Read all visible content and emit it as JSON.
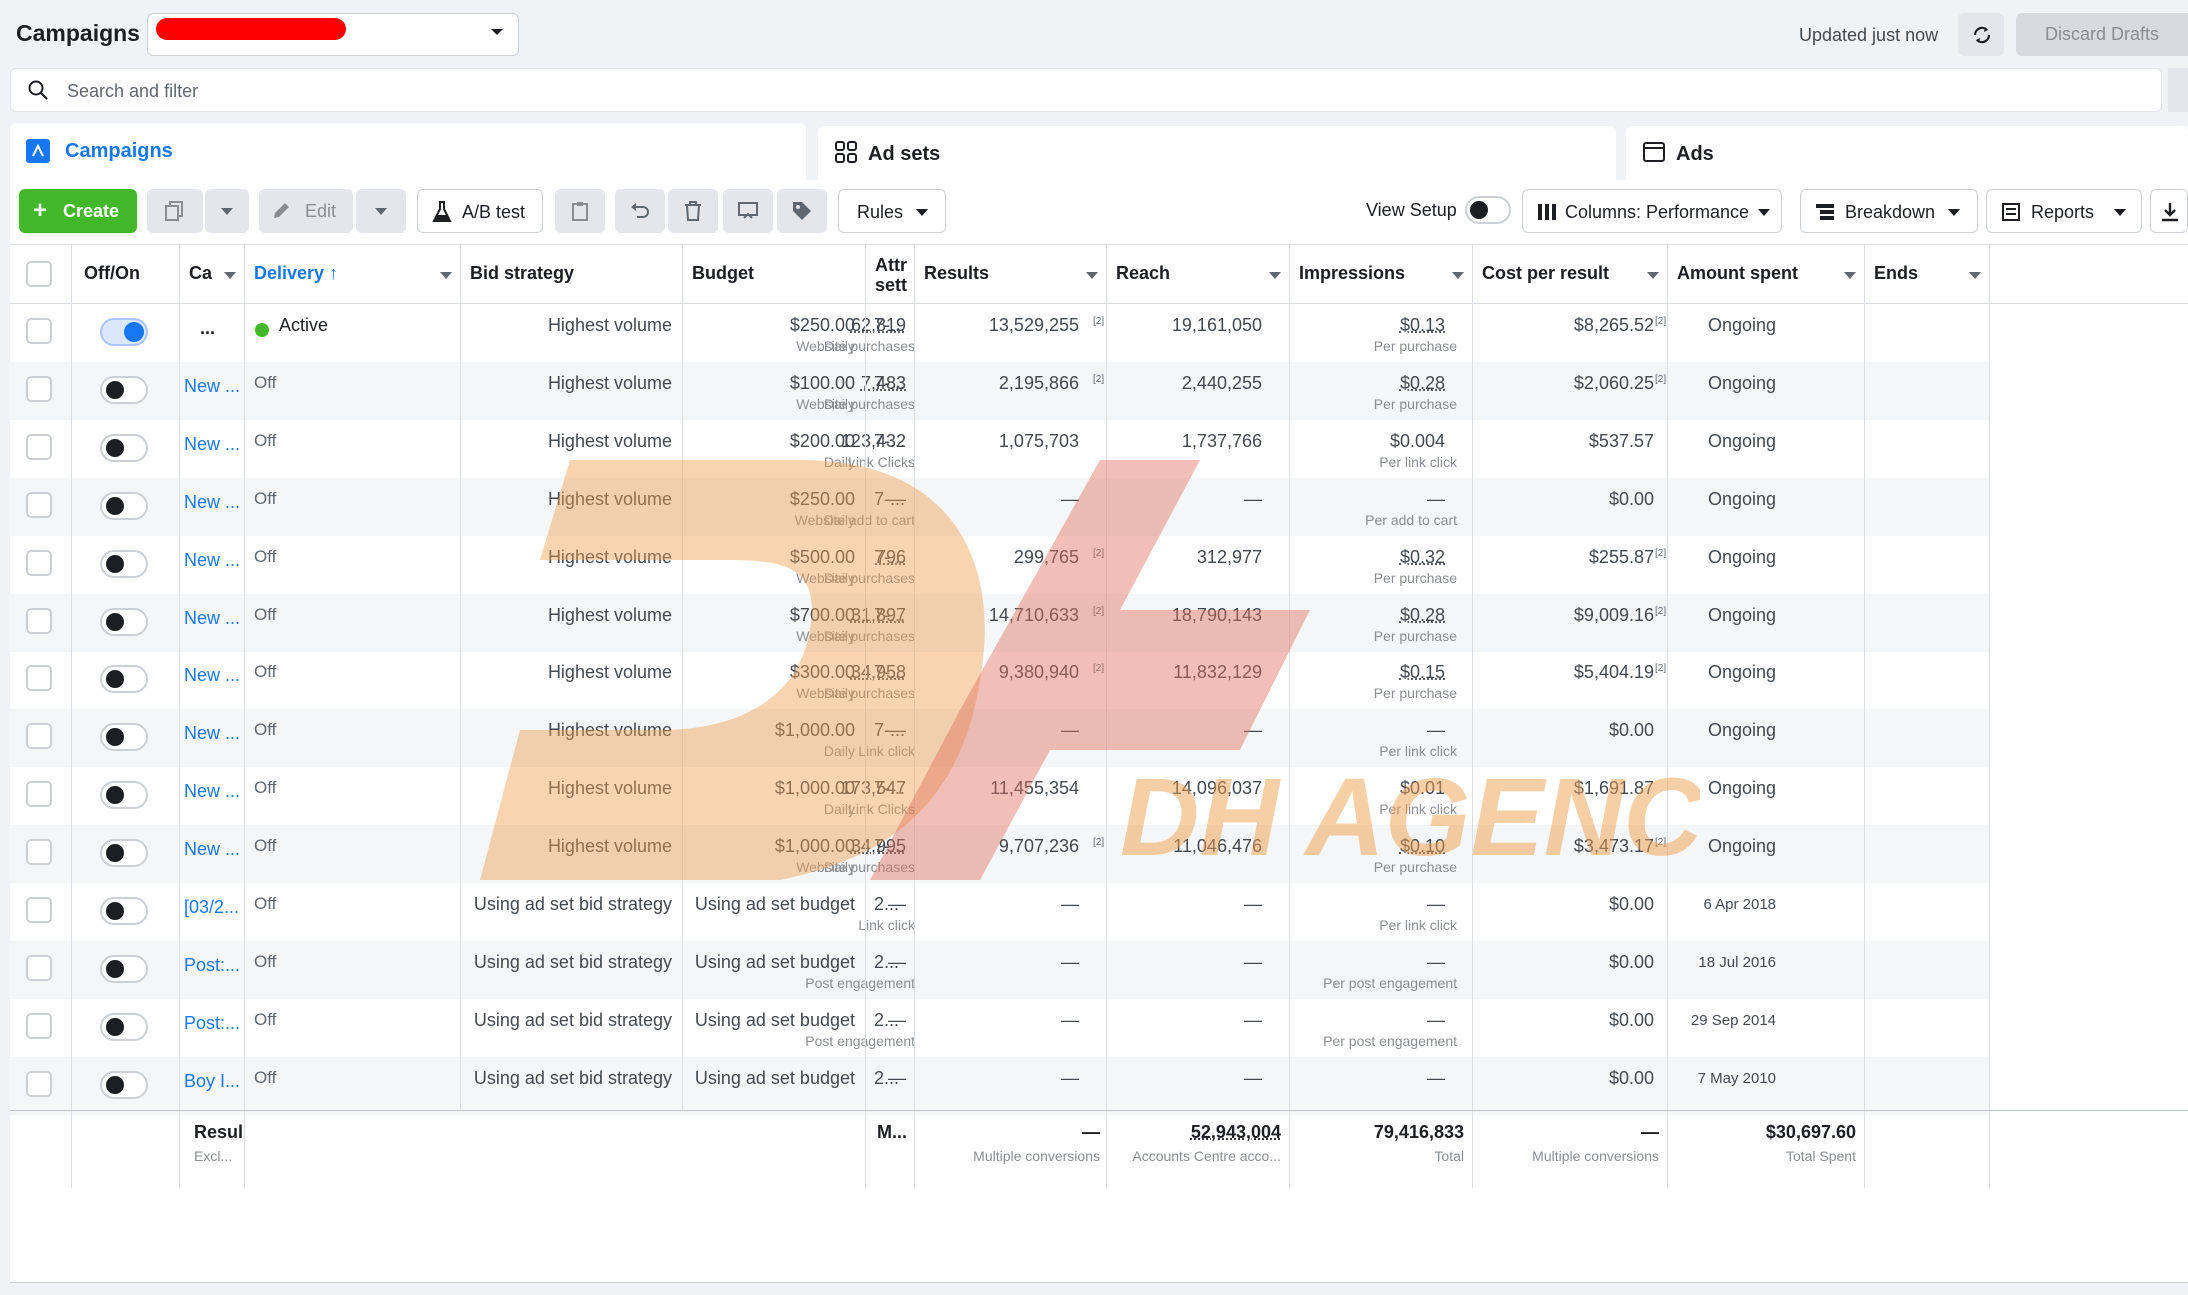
{
  "header": {
    "title": "Campaigns",
    "updated": "Updated just now",
    "discard": "Discard Drafts"
  },
  "search": {
    "placeholder": "Search and filter"
  },
  "tabs": {
    "campaigns": "Campaigns",
    "adsets": "Ad sets",
    "ads": "Ads"
  },
  "toolbar": {
    "create": "Create",
    "edit": "Edit",
    "ab_test": "A/B test",
    "rules": "Rules",
    "view_setup": "View Setup",
    "columns": "Columns: Performance",
    "breakdown": "Breakdown",
    "reports": "Reports"
  },
  "columns": {
    "offon": "Off/On",
    "campaign": "Ca",
    "delivery": "Delivery",
    "bid": "Bid strategy",
    "budget": "Budget",
    "attr": "Attr sett",
    "results": "Results",
    "reach": "Reach",
    "impressions": "Impressions",
    "cpr": "Cost per result",
    "spent": "Amount spent",
    "ends": "Ends"
  },
  "rows": [
    {
      "name": "...",
      "delivery": "Active",
      "bid": "Highest volume",
      "budget": "$250.00",
      "budget_sub": "Daily",
      "attr": "7-...",
      "results": "62,819",
      "results_sup": "[2]",
      "results_sub": "Website purchases",
      "reach": "13,529,255",
      "impressions": "19,161,050",
      "cpr": "$0.13",
      "cpr_sup": "[2]",
      "cpr_sub": "Per purchase",
      "spent": "$8,265.52",
      "ends": "Ongoing",
      "on": true
    },
    {
      "name": "New ...",
      "delivery": "Off",
      "bid": "Highest volume",
      "budget": "$100.00",
      "budget_sub": "Daily",
      "attr": "7-...",
      "results": "7,483",
      "results_sup": "[2]",
      "results_sub": "Website purchases",
      "reach": "2,195,866",
      "impressions": "2,440,255",
      "cpr": "$0.28",
      "cpr_sup": "[2]",
      "cpr_sub": "Per purchase",
      "spent": "$2,060.25",
      "ends": "Ongoing",
      "on": false
    },
    {
      "name": "New ...",
      "delivery": "Off",
      "bid": "Highest volume",
      "budget": "$200.00",
      "budget_sub": "Daily",
      "attr": "7-...",
      "results": "123,432",
      "results_sup": "",
      "results_sub": "Link Clicks",
      "reach": "1,075,703",
      "impressions": "1,737,766",
      "cpr": "$0.004",
      "cpr_sup": "",
      "cpr_sub": "Per link click",
      "spent": "$537.57",
      "ends": "Ongoing",
      "on": false
    },
    {
      "name": "New ...",
      "delivery": "Off",
      "bid": "Highest volume",
      "budget": "$250.00",
      "budget_sub": "Daily",
      "attr": "7-...",
      "results": "—",
      "results_sup": "",
      "results_sub": "Website add to cart",
      "reach": "—",
      "impressions": "—",
      "cpr": "—",
      "cpr_sup": "",
      "cpr_sub": "Per add to cart",
      "spent": "$0.00",
      "ends": "Ongoing",
      "on": false
    },
    {
      "name": "New ...",
      "delivery": "Off",
      "bid": "Highest volume",
      "budget": "$500.00",
      "budget_sub": "Daily",
      "attr": "7-...",
      "results": "796",
      "results_sup": "[2]",
      "results_sub": "Website purchases",
      "reach": "299,765",
      "impressions": "312,977",
      "cpr": "$0.32",
      "cpr_sup": "[2]",
      "cpr_sub": "Per purchase",
      "spent": "$255.87",
      "ends": "Ongoing",
      "on": false
    },
    {
      "name": "New ...",
      "delivery": "Off",
      "bid": "Highest volume",
      "budget": "$700.00",
      "budget_sub": "Daily",
      "attr": "7-...",
      "results": "31,897",
      "results_sup": "[2]",
      "results_sub": "Website purchases",
      "reach": "14,710,633",
      "impressions": "18,790,143",
      "cpr": "$0.28",
      "cpr_sup": "[2]",
      "cpr_sub": "Per purchase",
      "spent": "$9,009.16",
      "ends": "Ongoing",
      "on": false
    },
    {
      "name": "New ...",
      "delivery": "Off",
      "bid": "Highest volume",
      "budget": "$300.00",
      "budget_sub": "Daily",
      "attr": "7-...",
      "results": "34,958",
      "results_sup": "[2]",
      "results_sub": "Website purchases",
      "reach": "9,380,940",
      "impressions": "11,832,129",
      "cpr": "$0.15",
      "cpr_sup": "[2]",
      "cpr_sub": "Per purchase",
      "spent": "$5,404.19",
      "ends": "Ongoing",
      "on": false
    },
    {
      "name": "New ...",
      "delivery": "Off",
      "bid": "Highest volume",
      "budget": "$1,000.00",
      "budget_sub": "Daily",
      "attr": "7-...",
      "results": "—",
      "results_sup": "",
      "results_sub": "Link click",
      "reach": "—",
      "impressions": "—",
      "cpr": "—",
      "cpr_sup": "",
      "cpr_sub": "Per link click",
      "spent": "$0.00",
      "ends": "Ongoing",
      "on": false
    },
    {
      "name": "New ...",
      "delivery": "Off",
      "bid": "Highest volume",
      "budget": "$1,000.00",
      "budget_sub": "Daily",
      "attr": "7-...",
      "results": "173,547",
      "results_sup": "",
      "results_sub": "Link Clicks",
      "reach": "11,455,354",
      "impressions": "14,096,037",
      "cpr": "$0.01",
      "cpr_sup": "",
      "cpr_sub": "Per link click",
      "spent": "$1,691.87",
      "ends": "Ongoing",
      "on": false
    },
    {
      "name": "New ...",
      "delivery": "Off",
      "bid": "Highest volume",
      "budget": "$1,000.00",
      "budget_sub": "Daily",
      "attr": "7-...",
      "results": "34,995",
      "results_sup": "[2]",
      "results_sub": "Website purchases",
      "reach": "9,707,236",
      "impressions": "11,046,476",
      "cpr": "$0.10",
      "cpr_sup": "[2]",
      "cpr_sub": "Per purchase",
      "spent": "$3,473.17",
      "ends": "Ongoing",
      "on": false
    },
    {
      "name": "[03/2...",
      "delivery": "Off",
      "bid": "Using ad set bid strategy",
      "budget": "Using ad set budget",
      "budget_sub": "",
      "attr": "2...",
      "results": "—",
      "results_sup": "",
      "results_sub": "Link click",
      "reach": "—",
      "impressions": "—",
      "cpr": "—",
      "cpr_sup": "",
      "cpr_sub": "Per link click",
      "spent": "$0.00",
      "ends": "6 Apr 2018",
      "on": false
    },
    {
      "name": "Post:...",
      "delivery": "Off",
      "bid": "Using ad set bid strategy",
      "budget": "Using ad set budget",
      "budget_sub": "",
      "attr": "2...",
      "results": "—",
      "results_sup": "",
      "results_sub": "Post engagement",
      "reach": "—",
      "impressions": "—",
      "cpr": "—",
      "cpr_sup": "",
      "cpr_sub": "Per post engagement",
      "spent": "$0.00",
      "ends": "18 Jul 2016",
      "on": false
    },
    {
      "name": "Post:...",
      "delivery": "Off",
      "bid": "Using ad set bid strategy",
      "budget": "Using ad set budget",
      "budget_sub": "",
      "attr": "2...",
      "results": "—",
      "results_sup": "",
      "results_sub": "Post engagement",
      "reach": "—",
      "impressions": "—",
      "cpr": "—",
      "cpr_sup": "",
      "cpr_sub": "Per post engagement",
      "spent": "$0.00",
      "ends": "29 Sep 2014",
      "on": false
    },
    {
      "name": "Boy I...",
      "delivery": "Off",
      "bid": "Using ad set bid strategy",
      "budget": "Using ad set budget",
      "budget_sub": "",
      "attr": "2...",
      "results": "—",
      "results_sup": "",
      "results_sub": "",
      "reach": "—",
      "impressions": "—",
      "cpr": "—",
      "cpr_sup": "",
      "cpr_sub": "",
      "spent": "$0.00",
      "ends": "7 May 2010",
      "on": false
    }
  ],
  "summary": {
    "label": "Resul",
    "label_sub": "Excl...",
    "attr": "M...",
    "results": "—",
    "results_sub": "Multiple conversions",
    "reach": "52,943,004",
    "reach_sub": "Accounts Centre acco...",
    "impressions": "79,416,833",
    "impressions_sub": "Total",
    "cpr": "—",
    "cpr_sub": "Multiple conversions",
    "spent": "$30,697.60",
    "spent_sub": "Total Spent"
  },
  "watermark": {
    "text": "DH AGENCY"
  },
  "colors": {
    "accent": "#1877f2",
    "create": "#42b72a",
    "active_dot": "#42b72a",
    "watermark": "#f0a050"
  }
}
